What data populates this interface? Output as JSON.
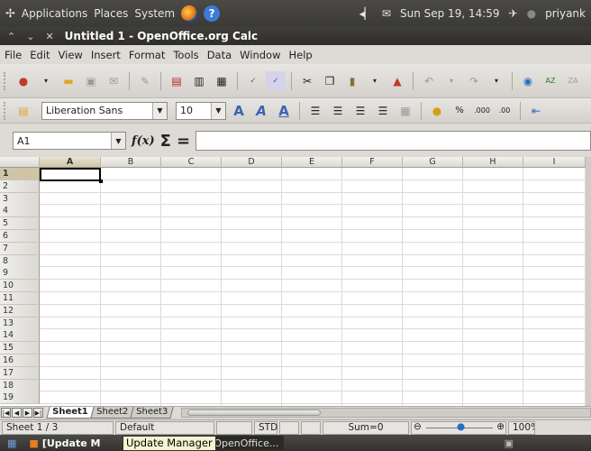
{
  "panel": {
    "menus": [
      "Applications",
      "Places",
      "System"
    ],
    "time": "Sun Sep 19, 14:59",
    "user": "priyank"
  },
  "window": {
    "title": "Untitled 1 - OpenOffice.org Calc"
  },
  "menubar": [
    "File",
    "Edit",
    "View",
    "Insert",
    "Format",
    "Tools",
    "Data",
    "Window",
    "Help"
  ],
  "format_toolbar": {
    "font_name": "Liberation Sans",
    "font_size": "10"
  },
  "formula_bar": {
    "cell_ref": "A1",
    "fx": "f(x)",
    "sigma": "Σ",
    "equals": "=",
    "content": ""
  },
  "columns": [
    "A",
    "B",
    "C",
    "D",
    "E",
    "F",
    "G",
    "H",
    "I"
  ],
  "rows": [
    "1",
    "2",
    "3",
    "4",
    "5",
    "6",
    "7",
    "8",
    "9",
    "10",
    "11",
    "12",
    "13",
    "14",
    "15",
    "16",
    "17",
    "18",
    "19"
  ],
  "sheet_tabs": [
    "Sheet1",
    "Sheet2",
    "Sheet3"
  ],
  "status": {
    "sheet": "Sheet 1 / 3",
    "style": "Default",
    "mode": "STD",
    "sum": "Sum=0",
    "zoom": "100%"
  },
  "taskbar": {
    "task1": "[Update M",
    "tooltip": "Update Manager",
    "task2": "Untitled 1 - OpenOffice..."
  },
  "colors": {
    "panel": "#3f3e3a",
    "selected_header": "#cfc5a5"
  }
}
